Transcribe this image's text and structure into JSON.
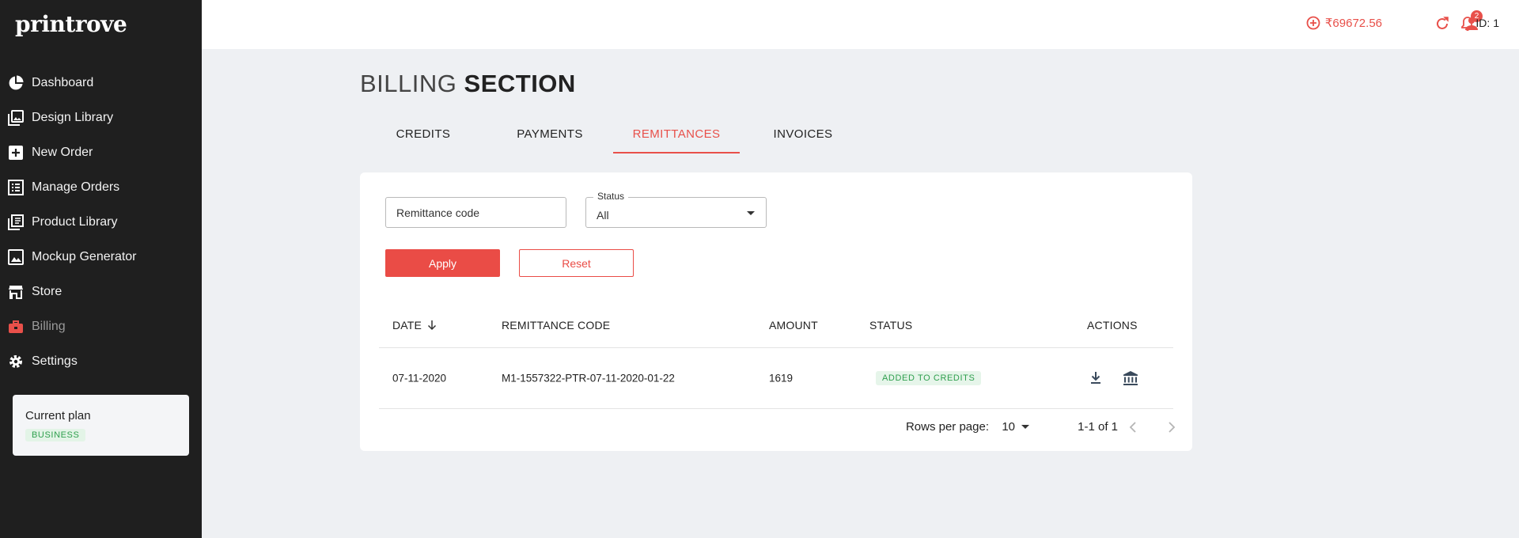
{
  "app": {
    "logo": "printrove"
  },
  "sidebar": {
    "items": [
      {
        "label": "Dashboard",
        "icon": "pie-chart-icon"
      },
      {
        "label": "Design Library",
        "icon": "images-icon"
      },
      {
        "label": "New Order",
        "icon": "add-box-icon"
      },
      {
        "label": "Manage Orders",
        "icon": "list-icon"
      },
      {
        "label": "Product Library",
        "icon": "library-icon"
      },
      {
        "label": "Mockup Generator",
        "icon": "image-icon"
      },
      {
        "label": "Store",
        "icon": "store-icon"
      },
      {
        "label": "Billing",
        "icon": "briefcase-icon",
        "active": true
      },
      {
        "label": "Settings",
        "icon": "gear-icon"
      }
    ],
    "plan": {
      "title": "Current plan",
      "badge": "BUSINESS"
    }
  },
  "topbar": {
    "balance": "₹69672.56",
    "notification_count": "2",
    "user_id": "ID: 1",
    "accent_color": "#e8504a"
  },
  "page": {
    "title_light": "BILLING",
    "title_bold": "SECTION",
    "tabs": [
      {
        "label": "CREDITS"
      },
      {
        "label": "PAYMENTS"
      },
      {
        "label": "REMITTANCES",
        "active": true
      },
      {
        "label": "INVOICES"
      }
    ]
  },
  "filters": {
    "code_placeholder": "Remittance code",
    "status_label": "Status",
    "status_value": "All",
    "apply_label": "Apply",
    "reset_label": "Reset"
  },
  "table": {
    "headers": {
      "date": "DATE",
      "code": "REMITTANCE CODE",
      "amount": "AMOUNT",
      "status": "STATUS",
      "actions": "ACTIONS"
    },
    "rows": [
      {
        "date": "07-11-2020",
        "code": "M1-1557322-PTR-07-11-2020-01-22",
        "amount": "1619",
        "status": "ADDED TO CREDITS"
      }
    ]
  },
  "pagination": {
    "rows_label": "Rows per page:",
    "rows_value": "10",
    "range": "1-1 of 1"
  }
}
